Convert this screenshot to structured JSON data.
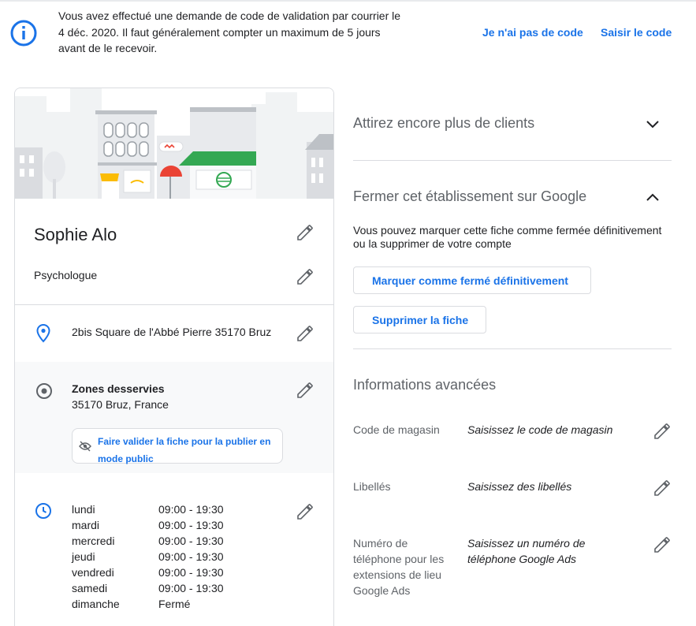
{
  "banner": {
    "message": "Vous avez effectué une demande de code de validation par courrier le 4 déc. 2020. Il faut généralement compter un maximum de 5 jours avant de le recevoir.",
    "no_code_link": "Je n'ai pas de code",
    "enter_code_link": "Saisir le code",
    "icon": "info-icon"
  },
  "business": {
    "name": "Sophie Alo",
    "category": "Psychologue",
    "address": "2bis Square de l'Abbé Pierre 35170 Bruz",
    "zones_title": "Zones desservies",
    "zones_value": "35170 Bruz, France",
    "zones_notice": "Faire valider la fiche pour la publier en mode public",
    "hours": [
      {
        "day": "lundi",
        "time": "09:00 - 19:30"
      },
      {
        "day": "mardi",
        "time": "09:00 - 19:30"
      },
      {
        "day": "mercredi",
        "time": "09:00 - 19:30"
      },
      {
        "day": "jeudi",
        "time": "09:00 - 19:30"
      },
      {
        "day": "vendredi",
        "time": "09:00 - 19:30"
      },
      {
        "day": "samedi",
        "time": "09:00 - 19:30"
      },
      {
        "day": "dimanche",
        "time": "Fermé"
      }
    ]
  },
  "right": {
    "attract_title": "Attirez encore plus de clients",
    "close_title": "Fermer cet établissement sur Google",
    "close_description": "Vous pouvez marquer cette fiche comme fermée définitivement ou la supprimer de votre compte",
    "mark_closed_button": "Marquer comme fermé définitivement",
    "delete_button": "Supprimer la fiche",
    "advanced_title": "Informations avancées",
    "advanced_rows": [
      {
        "label": "Code de magasin",
        "value": "Saisissez le code de magasin"
      },
      {
        "label": "Libellés",
        "value": "Saisissez des libellés"
      },
      {
        "label": "Numéro de téléphone pour les extensions de lieu Google Ads",
        "value": "Saisissez un numéro de téléphone Google Ads"
      }
    ]
  },
  "colors": {
    "accent": "#1a73e8",
    "text": "#202124",
    "secondary": "#5f6368",
    "divider": "#dadce0",
    "awning_green": "#34a853",
    "awning_red": "#ea4335",
    "awning_yellow": "#fbbc04"
  }
}
